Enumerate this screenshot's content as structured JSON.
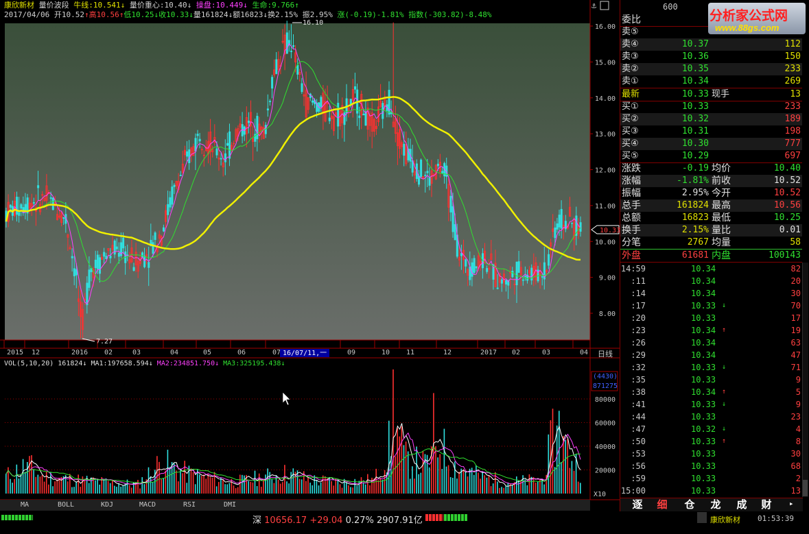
{
  "header": {
    "stock_name": "康欣新材",
    "indicator_name": "量价波段",
    "niu_line": "牛线:10.541",
    "liangjia_center": "量价重心:10.40",
    "caopan": "操盘:10.449",
    "shengming": "生命:9.766",
    "date": "2017/04/06",
    "open": "开10.52",
    "high": "高10.56",
    "low": "低10.25",
    "close": "收10.33",
    "volume": "量161824",
    "amount": "额16823",
    "turnover": "换2.15%",
    "amplitude": "振2.95%",
    "change": "涨(-0.19)-1.81%",
    "index": "指数(-303.82)-8.48%"
  },
  "price_axis": [
    "16.00",
    "15.00",
    "14.00",
    "13.00",
    "12.00",
    "11.00",
    "10.00",
    "9.00",
    "8.00"
  ],
  "price_marker": "10.33",
  "peak_label": "16.10",
  "low_label": "7.27",
  "date_axis": [
    "2015",
    "12",
    "2016",
    "02",
    "03",
    "04",
    "05",
    "06",
    "07",
    "09",
    "10",
    "11",
    "12",
    "2017",
    "02",
    "03",
    "04"
  ],
  "date_cursor": "16/07/11,一",
  "period_label": "日线",
  "vol_header": {
    "name": "VOL(5,10,20)",
    "vol": "161824",
    "ma1": "MA1:197658.594",
    "ma2": "MA2:234851.750",
    "ma3": "MA3:325195.438"
  },
  "vol_axis": [
    "80000",
    "60000",
    "40000",
    "20000"
  ],
  "vol_top_label": "(4430)",
  "vol_top_value": "871275",
  "vol_unit": "X10",
  "indicator_tabs": [
    "MA",
    "BOLL",
    "KDJ",
    "MACD",
    "RSI",
    "DMI"
  ],
  "logo": {
    "title": "分析家公式网",
    "url": "www.88gs.com",
    "code_partial": "600"
  },
  "order_book": {
    "weibi_label": "委比",
    "sell": [
      {
        "label": "卖⑤",
        "price": "",
        "qty": ""
      },
      {
        "label": "卖④",
        "price": "10.37",
        "qty": "112"
      },
      {
        "label": "卖③",
        "price": "10.36",
        "qty": "150"
      },
      {
        "label": "卖②",
        "price": "10.35",
        "qty": "233"
      },
      {
        "label": "卖①",
        "price": "10.34",
        "qty": "269"
      }
    ],
    "latest_label": "最新",
    "latest_price": "10.33",
    "current_hand_label": "现手",
    "current_hand": "13",
    "buy": [
      {
        "label": "买①",
        "price": "10.33",
        "qty": "233"
      },
      {
        "label": "买②",
        "price": "10.32",
        "qty": "189"
      },
      {
        "label": "买③",
        "price": "10.31",
        "qty": "198"
      },
      {
        "label": "买④",
        "price": "10.30",
        "qty": "777"
      },
      {
        "label": "买⑤",
        "price": "10.29",
        "qty": "697"
      }
    ]
  },
  "stats": [
    {
      "l1": "涨跌",
      "v1": "-0.19",
      "l2": "均价",
      "v2": "10.40"
    },
    {
      "l1": "涨幅",
      "v1": "-1.81%",
      "l2": "前收",
      "v2": "10.52"
    },
    {
      "l1": "振幅",
      "v1": "2.95%",
      "l2": "今开",
      "v2": "10.52"
    },
    {
      "l1": "总手",
      "v1": "161824",
      "l2": "最高",
      "v2": "10.56"
    },
    {
      "l1": "总额",
      "v1": "16823",
      "l2": "最低",
      "v2": "10.25"
    },
    {
      "l1": "换手",
      "v1": "2.15%",
      "l2": "量比",
      "v2": "0.01"
    },
    {
      "l1": "分笔",
      "v1": "2767",
      "l2": "均量",
      "v2": "58"
    }
  ],
  "outer_label": "外盘",
  "outer_value": "61681",
  "inner_label": "内盘",
  "inner_value": "100143",
  "ticks": [
    {
      "t": "14:59",
      "p": "10.34",
      "a": "",
      "q": "82"
    },
    {
      "t": ":11",
      "p": "10.34",
      "a": "",
      "q": "20"
    },
    {
      "t": ":14",
      "p": "10.34",
      "a": "",
      "q": "30"
    },
    {
      "t": ":17",
      "p": "10.33",
      "a": "↓",
      "q": "70"
    },
    {
      "t": ":20",
      "p": "10.33",
      "a": "",
      "q": "17"
    },
    {
      "t": ":23",
      "p": "10.34",
      "a": "↑",
      "q": "19"
    },
    {
      "t": ":26",
      "p": "10.34",
      "a": "",
      "q": "63"
    },
    {
      "t": ":29",
      "p": "10.34",
      "a": "",
      "q": "47"
    },
    {
      "t": ":32",
      "p": "10.33",
      "a": "↓",
      "q": "71"
    },
    {
      "t": ":35",
      "p": "10.33",
      "a": "",
      "q": "9"
    },
    {
      "t": ":38",
      "p": "10.34",
      "a": "↑",
      "q": "5"
    },
    {
      "t": ":41",
      "p": "10.33",
      "a": "↓",
      "q": "9"
    },
    {
      "t": ":44",
      "p": "10.33",
      "a": "",
      "q": "23"
    },
    {
      "t": ":47",
      "p": "10.32",
      "a": "↓",
      "q": "4"
    },
    {
      "t": ":50",
      "p": "10.33",
      "a": "↑",
      "q": "8"
    },
    {
      "t": ":53",
      "p": "10.33",
      "a": "",
      "q": "30"
    },
    {
      "t": ":56",
      "p": "10.33",
      "a": "",
      "q": "68"
    },
    {
      "t": ":59",
      "p": "10.33",
      "a": "",
      "q": "2"
    },
    {
      "t": "15:00",
      "p": "10.33",
      "a": "",
      "q": "13"
    }
  ],
  "nav_buttons": [
    "逐",
    "细",
    "仓",
    "龙",
    "成",
    "财"
  ],
  "ticker": {
    "market": "深",
    "index": "10656.17",
    "change": "+29.04",
    "pct": "0.27%",
    "amount": "2907.91亿"
  },
  "status": {
    "stock": "康欣新材",
    "time": "01:53:39"
  }
}
